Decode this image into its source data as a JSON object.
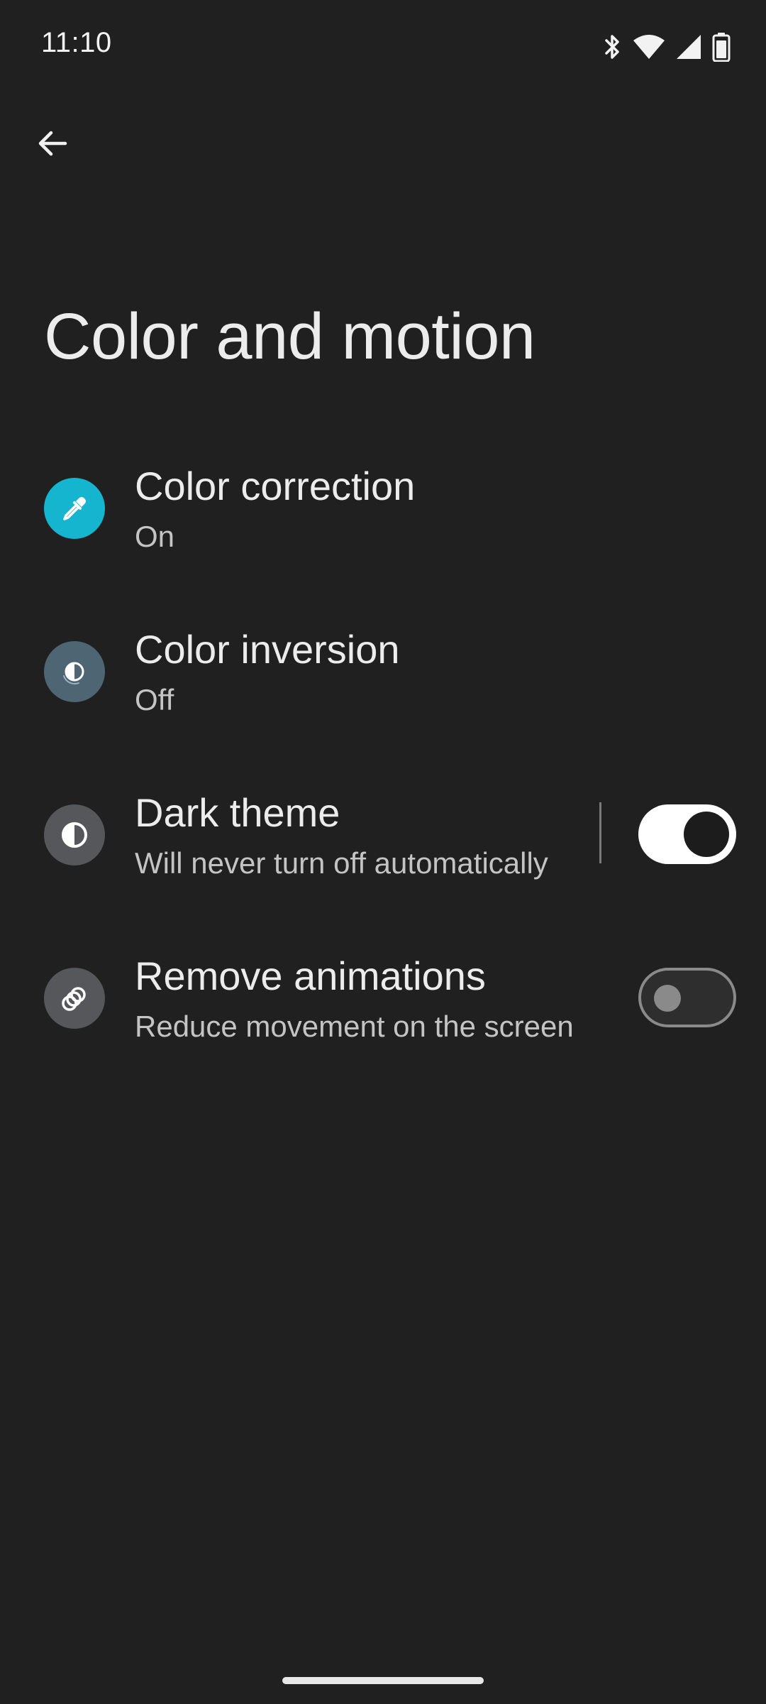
{
  "status_bar": {
    "time": "11:10",
    "icons": [
      "bluetooth-icon",
      "wifi-icon",
      "cell-signal-icon",
      "battery-icon"
    ]
  },
  "header": {
    "back_icon": "arrow-back-icon",
    "title": "Color and motion"
  },
  "settings": [
    {
      "title": "Color correction",
      "summary": "On",
      "icon": "eyedropper-icon",
      "icon_bg": "#15b4cf"
    },
    {
      "title": "Color inversion",
      "summary": "Off",
      "icon": "color-inversion-icon",
      "icon_bg": "#4e6574"
    },
    {
      "title": "Dark theme",
      "summary": "Will never turn off automatically",
      "icon": "dark-theme-icon",
      "icon_bg": "#55575a",
      "toggle": true
    },
    {
      "title": "Remove animations",
      "summary": "Reduce movement on the screen",
      "icon": "remove-animations-icon",
      "icon_bg": "#55575a",
      "toggle": false
    }
  ],
  "colors": {
    "background": "#202020",
    "accent": "#15b4cf"
  }
}
